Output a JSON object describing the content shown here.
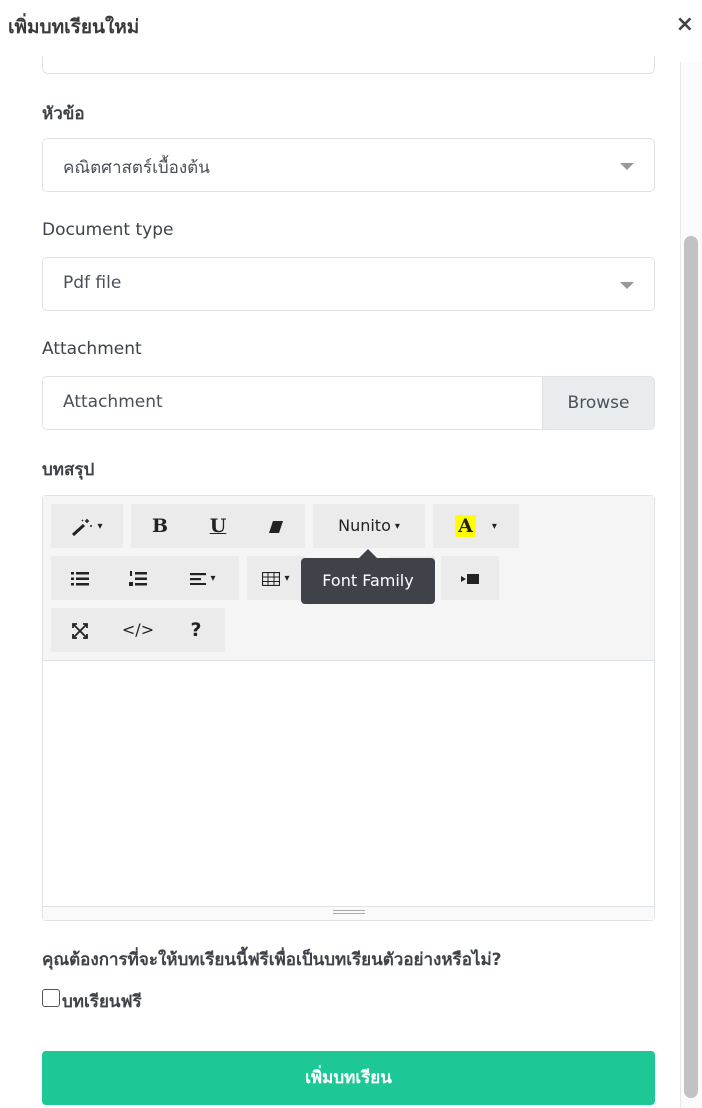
{
  "modal": {
    "title": "เพิ่มบทเรียนใหม่",
    "close_glyph": "×"
  },
  "form": {
    "topic_label": "หัวข้อ",
    "topic_value": "คณิตศาสตร์เบื้องต้น",
    "doctype_label": "Document type",
    "doctype_value": "Pdf file",
    "attachment_label": "Attachment",
    "attachment_placeholder": "Attachment",
    "browse_label": "Browse",
    "summary_label": "บทสรุป",
    "free_question": "คุณต้องการที่จะให้บทเรียนนี้ฟรีเพื่อเป็นบทเรียนตัวอย่างหรือไม่?",
    "free_checkbox_label": "บทเรียนฟรี",
    "free_checked": false,
    "submit_label": "เพิ่มบทเรียน"
  },
  "editor": {
    "toolbar": {
      "style_glyph": "🪄",
      "bold": "B",
      "underline": "U",
      "font_family_value": "Nunito",
      "color_glyph": "A",
      "codeview_glyph": "</>",
      "help_glyph": "?",
      "tooltip": "Font Family"
    },
    "content": ""
  },
  "colors": {
    "primary": "#1ec896",
    "highlight_yellow": "#ffff00"
  }
}
